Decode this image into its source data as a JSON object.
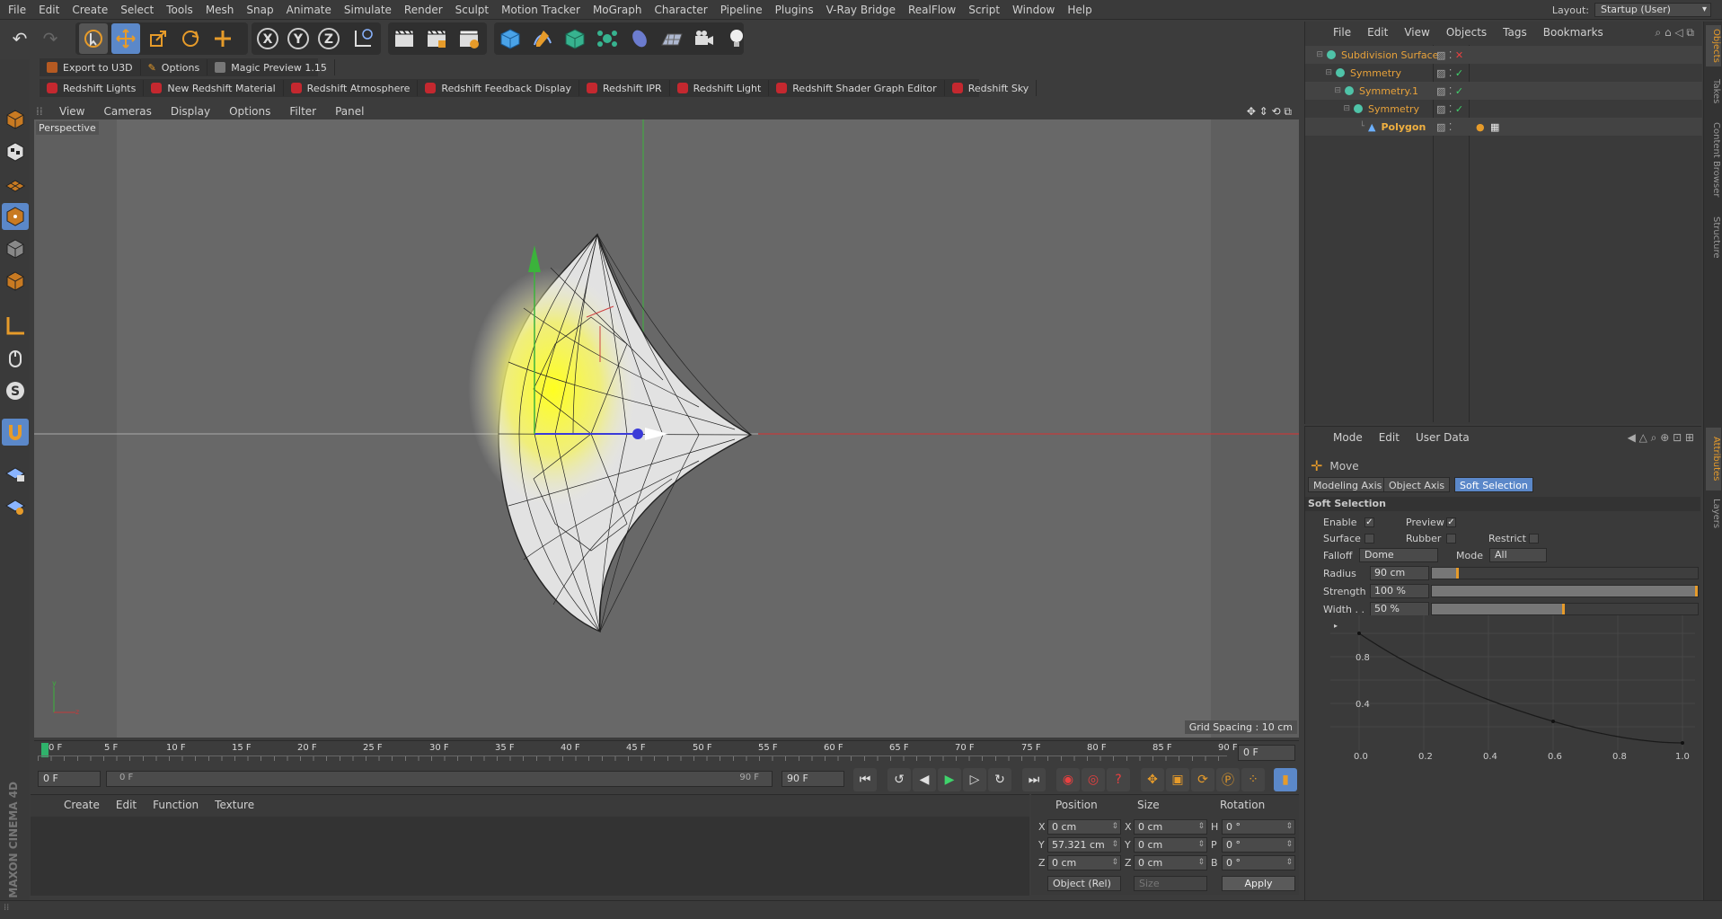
{
  "menubar": {
    "items": [
      "File",
      "Edit",
      "Create",
      "Select",
      "Tools",
      "Mesh",
      "Snap",
      "Animate",
      "Simulate",
      "Render",
      "Sculpt",
      "Motion Tracker",
      "MoGraph",
      "Character",
      "Pipeline",
      "Plugins",
      "V-Ray Bridge",
      "RealFlow",
      "Script",
      "Window",
      "Help"
    ],
    "layout_label": "Layout:",
    "layout_value": "Startup (User)"
  },
  "plugin_bar_1": {
    "items": [
      "Export to U3D",
      "Options",
      "Magic Preview 1.15"
    ]
  },
  "plugin_bar_2": {
    "items": [
      "Redshift Lights",
      "New Redshift Material",
      "Redshift Atmosphere",
      "Redshift Feedback Display",
      "Redshift IPR",
      "Redshift Light",
      "Redshift Shader Graph Editor",
      "Redshift Sky"
    ]
  },
  "viewport": {
    "menu": [
      "View",
      "Cameras",
      "Display",
      "Options",
      "Filter",
      "Panel"
    ],
    "label": "Perspective",
    "grid_spacing": "Grid Spacing : 10 cm",
    "colors": {
      "x_axis": "#c23b3b",
      "y_axis": "#3bb33b",
      "z_axis": "#3b3bd8",
      "selection": "#ffff30"
    }
  },
  "timeline": {
    "ticks": [
      "0 F",
      "5 F",
      "10 F",
      "15 F",
      "20 F",
      "25 F",
      "30 F",
      "35 F",
      "40 F",
      "45 F",
      "50 F",
      "55 F",
      "60 F",
      "65 F",
      "70 F",
      "75 F",
      "80 F",
      "85 F",
      "90 F"
    ],
    "current_frame": "0 F",
    "start_field": "0 F",
    "range_start": "0 F",
    "range_end": "90 F",
    "end_field": "90 F"
  },
  "material_manager": {
    "menu": [
      "Create",
      "Edit",
      "Function",
      "Texture"
    ]
  },
  "coordinates": {
    "headers": [
      "Position",
      "Size",
      "Rotation"
    ],
    "rows": [
      {
        "pl": "X",
        "pos": "0 cm",
        "sl": "X",
        "size": "0 cm",
        "rl": "H",
        "rot": "0 °"
      },
      {
        "pl": "Y",
        "pos": "57.321 cm",
        "sl": "Y",
        "size": "0 cm",
        "rl": "P",
        "rot": "0 °"
      },
      {
        "pl": "Z",
        "pos": "0 cm",
        "sl": "Z",
        "size": "0 cm",
        "rl": "B",
        "rot": "0 °"
      }
    ],
    "mode": "Object (Rel)",
    "size_mode": "Size",
    "apply": "Apply"
  },
  "objects": {
    "menu": [
      "File",
      "Edit",
      "View",
      "Objects",
      "Tags",
      "Bookmarks"
    ],
    "tree": [
      {
        "name": "Subdivision Surface",
        "depth": 0
      },
      {
        "name": "Symmetry",
        "depth": 1
      },
      {
        "name": "Symmetry.1",
        "depth": 2
      },
      {
        "name": "Symmetry",
        "depth": 3
      },
      {
        "name": "Polygon",
        "depth": 4
      }
    ]
  },
  "attributes": {
    "menu": [
      "Mode",
      "Edit",
      "User Data"
    ],
    "tool": "Move",
    "tabs": [
      "Modeling Axis",
      "Object Axis",
      "Soft Selection"
    ],
    "section": "Soft Selection",
    "enable": "Enable",
    "preview": "Preview",
    "surface": "Surface",
    "rubber": "Rubber",
    "restrict": "Restrict",
    "falloff_label": "Falloff",
    "falloff_value": "Dome",
    "mode_label": "Mode",
    "mode_value": "All",
    "radius_label": "Radius",
    "radius_value": "90 cm",
    "strength_label": "Strength",
    "strength_value": "100 %",
    "width_label": "Width . .",
    "width_value": "50 %",
    "sliders": {
      "radius": 0.1,
      "strength": 1.0,
      "width": 0.5
    },
    "graph": {
      "y_ticks": [
        "0.8",
        "0.4"
      ],
      "x_ticks": [
        "0.0",
        "0.2",
        "0.4",
        "0.6",
        "0.8",
        "1.0"
      ]
    }
  },
  "side_tabs": [
    "Objects",
    "Takes",
    "Content Browser",
    "Structure",
    "Attributes",
    "Layers"
  ],
  "branding": "MAXON CINEMA 4D"
}
